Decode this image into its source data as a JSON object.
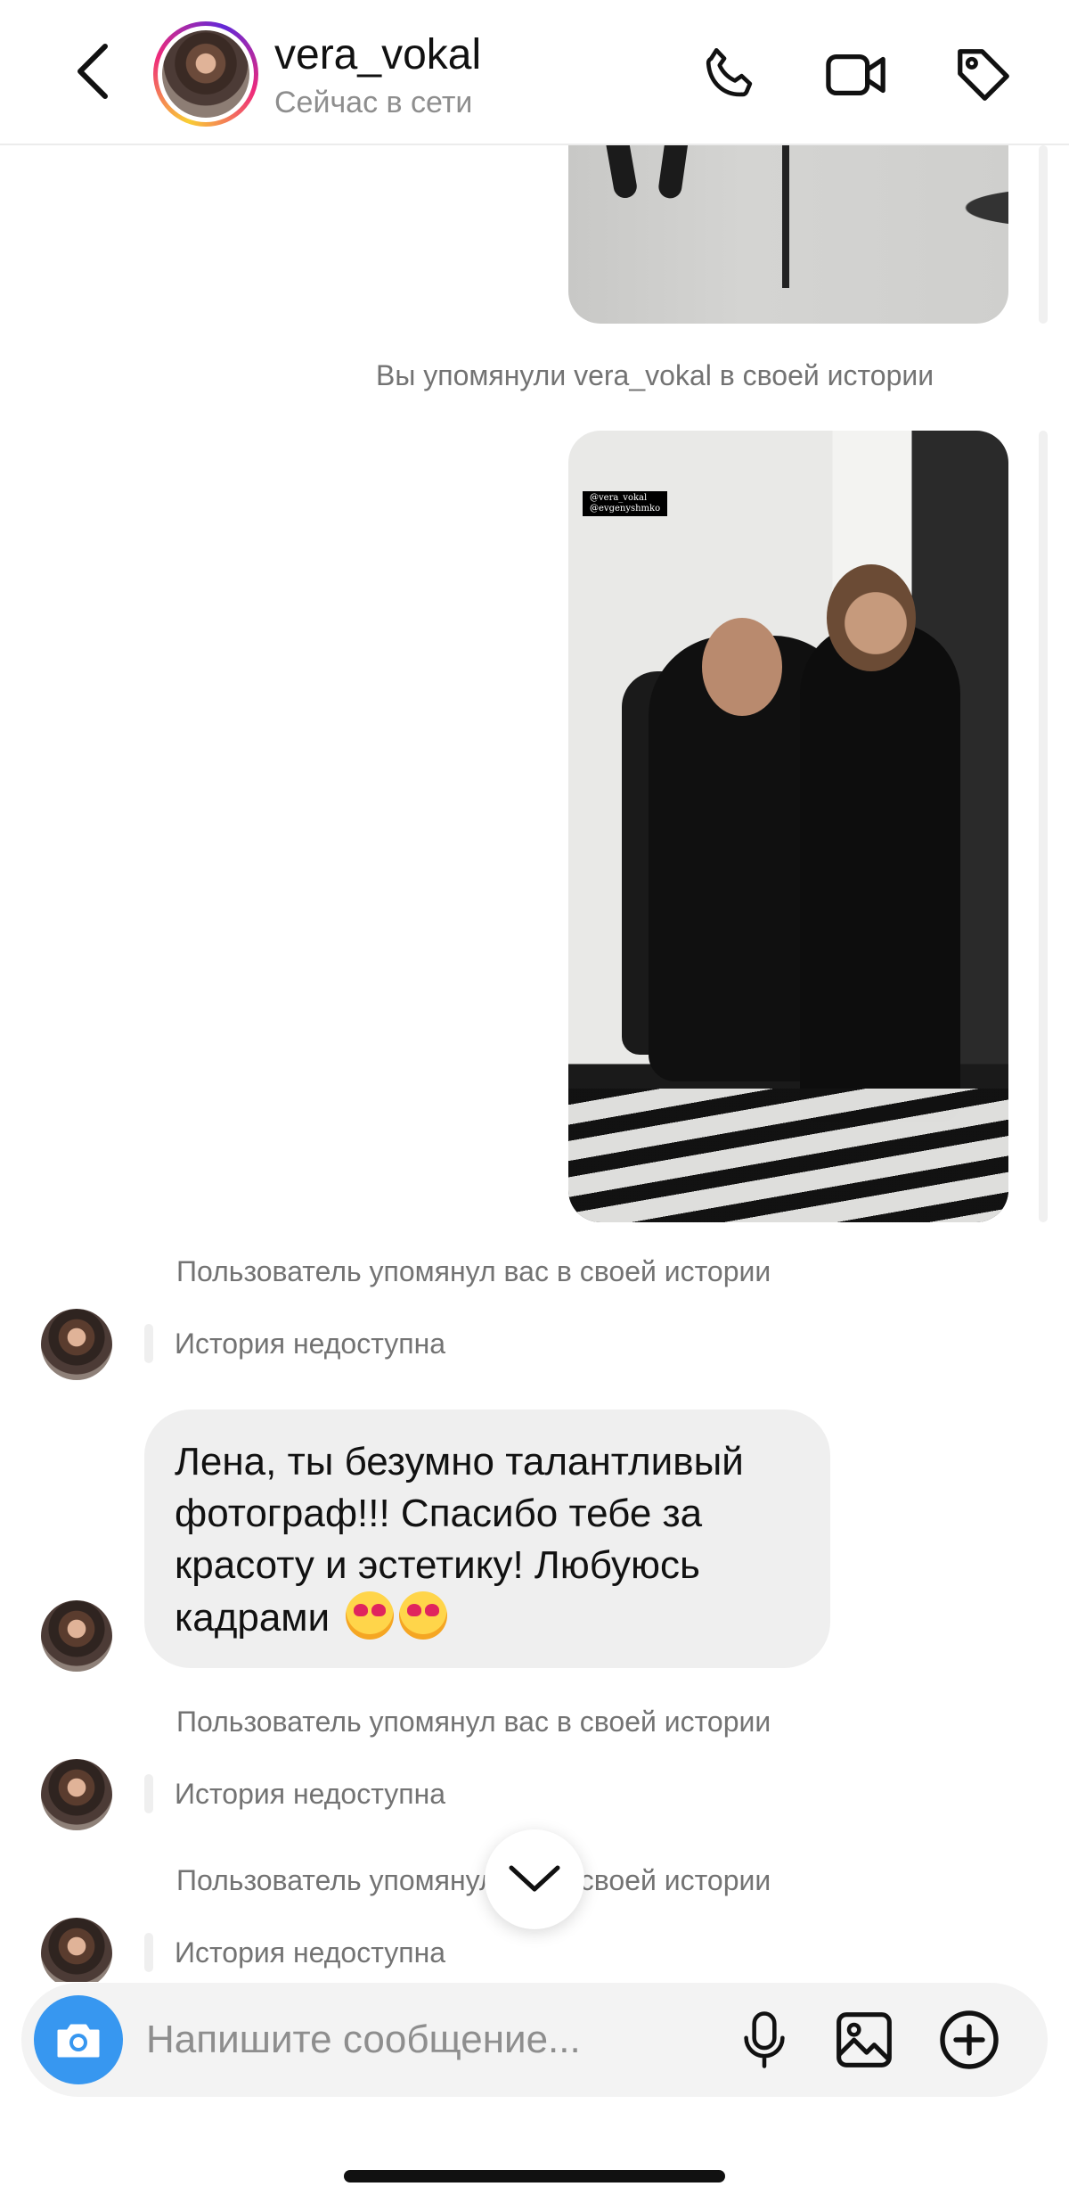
{
  "header": {
    "username": "vera_vokal",
    "status": "Сейчас в сети",
    "icons": [
      "back-icon",
      "phone-icon",
      "video-icon",
      "tag-icon"
    ]
  },
  "thread": {
    "note_you_mentioned": "Вы упомянули vera_vokal в своей истории",
    "story_tag_line1": "@vera_vokal",
    "story_tag_line2": "@evgenyshmko",
    "note_user_mentioned_1": "Пользователь упомянул вас в своей истории",
    "unavailable_1": "История недоступна",
    "message_text": "Лена, ты безумно талантливый фотограф!!! Спасибо тебе за красоту и эстетику! Любуюсь кадрами",
    "message_emoji": "heart-eyes-emoji",
    "note_user_mentioned_2": "Пользователь упомянул вас в своей истории",
    "unavailable_2": "История недоступна",
    "note_user_mentioned_3": "Пользователь упомянул вас в своей истории",
    "unavailable_3": "История недоступна"
  },
  "composer": {
    "placeholder": "Напишите сообщение...",
    "icons": [
      "camera-icon",
      "microphone-icon",
      "gallery-icon",
      "plus-icon"
    ]
  },
  "colors": {
    "accent": "#3797f0",
    "bubble": "#efefef",
    "muted_text": "#737373"
  }
}
